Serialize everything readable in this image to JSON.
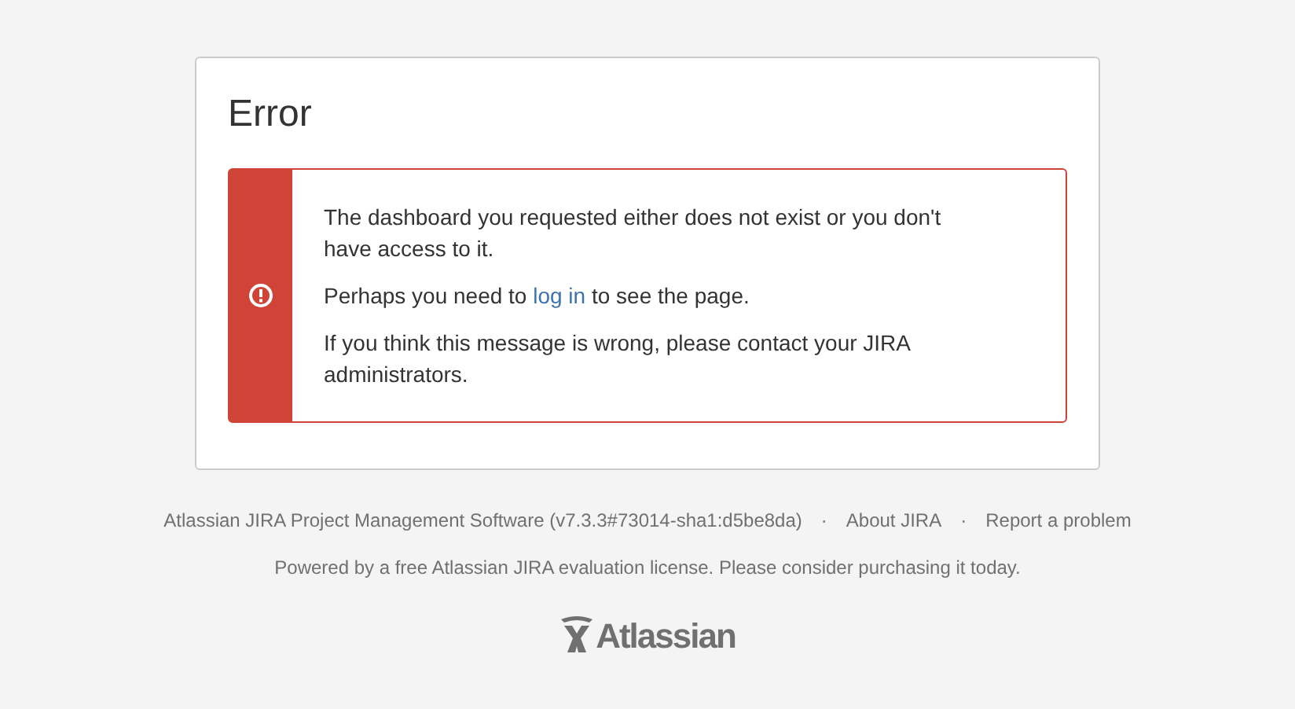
{
  "card": {
    "title": "Error",
    "message": {
      "paragraphs": [
        {
          "kind": "text",
          "text": "The dashboard you requested either does not exist or you don't have access to it."
        },
        {
          "kind": "link",
          "before": "Perhaps you need to ",
          "link": "log in",
          "after": " to see the page."
        },
        {
          "kind": "text",
          "text": "If you think this message is wrong, please contact your JIRA administrators."
        }
      ]
    }
  },
  "footer": {
    "links": [
      {
        "kind": "text",
        "text": "Atlassian JIRA Project Management Software (v7.3.3#73014-sha1:d5be8da)"
      },
      {
        "kind": "sep",
        "text": "·"
      },
      {
        "kind": "link",
        "text": "About JIRA"
      },
      {
        "kind": "sep",
        "text": "·"
      },
      {
        "kind": "link",
        "text": "Report a problem"
      }
    ],
    "license": "Powered by a free Atlassian JIRA evaluation license. Please consider purchasing it today.",
    "logo": "Atlassian"
  }
}
